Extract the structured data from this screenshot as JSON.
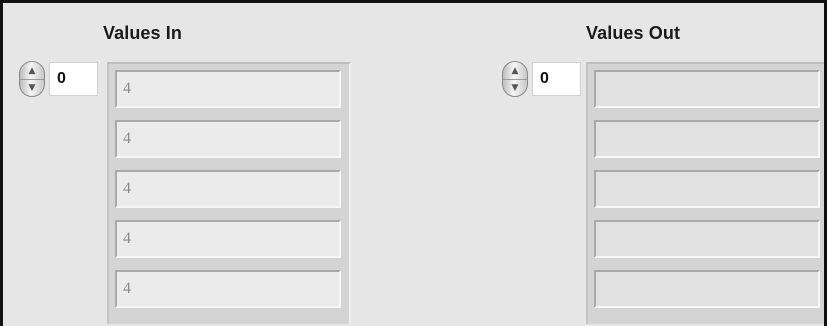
{
  "values_in": {
    "label": "Values In",
    "index": "0",
    "cells": [
      "4",
      "4",
      "4",
      "4",
      "4"
    ]
  },
  "values_out": {
    "label": "Values Out",
    "index": "0",
    "cells": [
      "",
      "",
      "",
      "",
      ""
    ]
  },
  "icons": {
    "spinner_up": "▲",
    "spinner_down": "▼"
  }
}
